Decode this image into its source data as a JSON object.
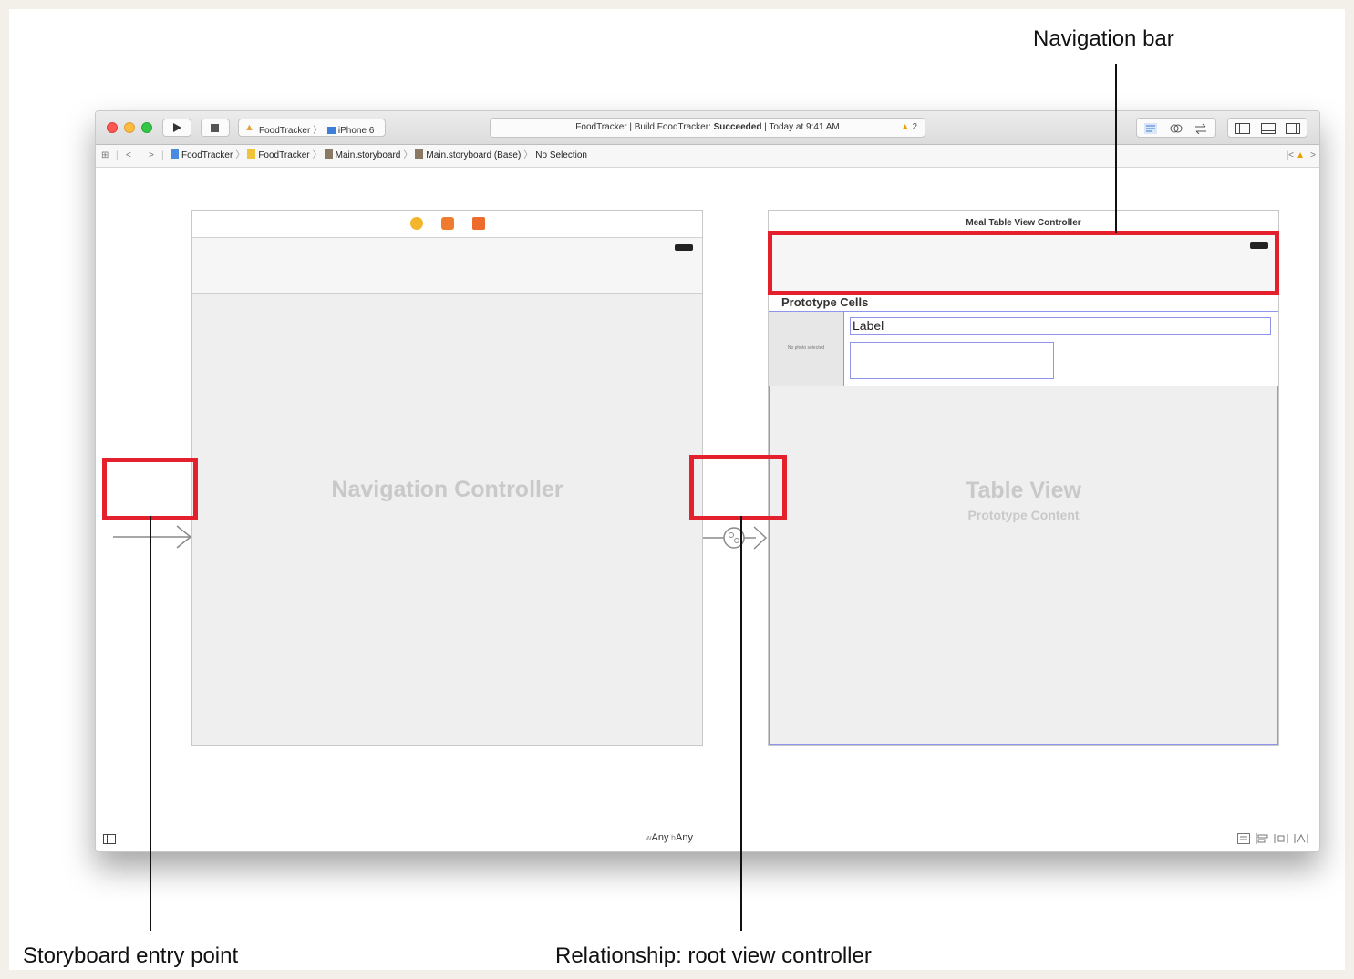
{
  "window": {
    "scheme_app": "FoodTracker",
    "scheme_sep": "〉",
    "scheme_device": "iPhone 6",
    "activity_prefix": "FoodTracker  |  Build FoodTracker: ",
    "activity_status": "Succeeded",
    "activity_suffix": "  |  Today at 9:41 AM",
    "warning_count": "2"
  },
  "jumpbar": {
    "crumbs": [
      "FoodTracker",
      "FoodTracker",
      "Main.storyboard",
      "Main.storyboard (Base)",
      "No Selection"
    ],
    "separator": "〉"
  },
  "canvas": {
    "nav_controller_title": "Navigation Controller",
    "table_scene_title": "Meal Table View Controller",
    "prototype_cells_label": "Prototype Cells",
    "cell_label_text": "Label",
    "photo_placeholder": "No photo selected",
    "table_view_title": "Table View",
    "table_view_subtitle": "Prototype Content"
  },
  "bottombar": {
    "size_w_prefix": "w",
    "size_w": "Any",
    "size_h_prefix": " h",
    "size_h": "Any"
  },
  "callouts": {
    "navigation_bar": "Navigation bar",
    "entry_point": "Storyboard entry point",
    "relationship": "Relationship: root view controller"
  },
  "colors": {
    "highlight_red": "#e3202b",
    "selection_blue": "#8f94ec",
    "warning_yellow": "#e6a000"
  }
}
